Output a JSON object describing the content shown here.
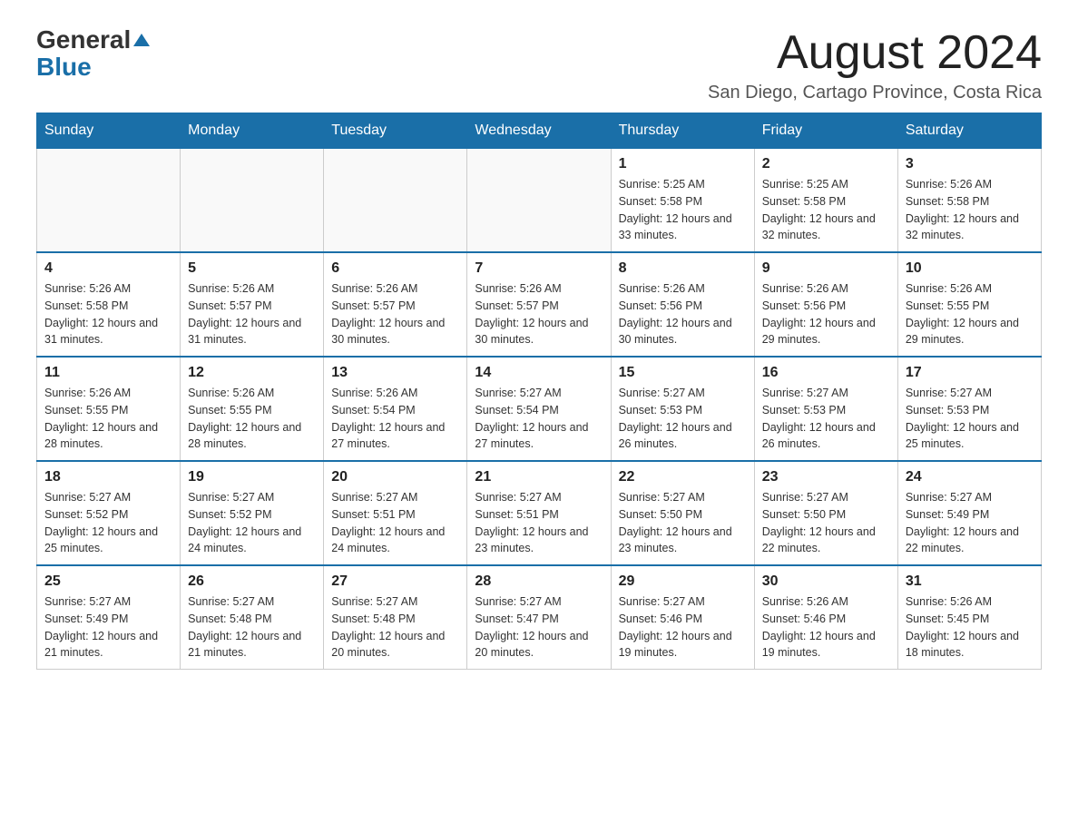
{
  "header": {
    "logo_general": "General",
    "logo_blue": "Blue",
    "month_title": "August 2024",
    "location": "San Diego, Cartago Province, Costa Rica"
  },
  "days_of_week": [
    "Sunday",
    "Monday",
    "Tuesday",
    "Wednesday",
    "Thursday",
    "Friday",
    "Saturday"
  ],
  "weeks": [
    {
      "days": [
        {
          "number": "",
          "info": ""
        },
        {
          "number": "",
          "info": ""
        },
        {
          "number": "",
          "info": ""
        },
        {
          "number": "",
          "info": ""
        },
        {
          "number": "1",
          "info": "Sunrise: 5:25 AM\nSunset: 5:58 PM\nDaylight: 12 hours and 33 minutes."
        },
        {
          "number": "2",
          "info": "Sunrise: 5:25 AM\nSunset: 5:58 PM\nDaylight: 12 hours and 32 minutes."
        },
        {
          "number": "3",
          "info": "Sunrise: 5:26 AM\nSunset: 5:58 PM\nDaylight: 12 hours and 32 minutes."
        }
      ]
    },
    {
      "days": [
        {
          "number": "4",
          "info": "Sunrise: 5:26 AM\nSunset: 5:58 PM\nDaylight: 12 hours and 31 minutes."
        },
        {
          "number": "5",
          "info": "Sunrise: 5:26 AM\nSunset: 5:57 PM\nDaylight: 12 hours and 31 minutes."
        },
        {
          "number": "6",
          "info": "Sunrise: 5:26 AM\nSunset: 5:57 PM\nDaylight: 12 hours and 30 minutes."
        },
        {
          "number": "7",
          "info": "Sunrise: 5:26 AM\nSunset: 5:57 PM\nDaylight: 12 hours and 30 minutes."
        },
        {
          "number": "8",
          "info": "Sunrise: 5:26 AM\nSunset: 5:56 PM\nDaylight: 12 hours and 30 minutes."
        },
        {
          "number": "9",
          "info": "Sunrise: 5:26 AM\nSunset: 5:56 PM\nDaylight: 12 hours and 29 minutes."
        },
        {
          "number": "10",
          "info": "Sunrise: 5:26 AM\nSunset: 5:55 PM\nDaylight: 12 hours and 29 minutes."
        }
      ]
    },
    {
      "days": [
        {
          "number": "11",
          "info": "Sunrise: 5:26 AM\nSunset: 5:55 PM\nDaylight: 12 hours and 28 minutes."
        },
        {
          "number": "12",
          "info": "Sunrise: 5:26 AM\nSunset: 5:55 PM\nDaylight: 12 hours and 28 minutes."
        },
        {
          "number": "13",
          "info": "Sunrise: 5:26 AM\nSunset: 5:54 PM\nDaylight: 12 hours and 27 minutes."
        },
        {
          "number": "14",
          "info": "Sunrise: 5:27 AM\nSunset: 5:54 PM\nDaylight: 12 hours and 27 minutes."
        },
        {
          "number": "15",
          "info": "Sunrise: 5:27 AM\nSunset: 5:53 PM\nDaylight: 12 hours and 26 minutes."
        },
        {
          "number": "16",
          "info": "Sunrise: 5:27 AM\nSunset: 5:53 PM\nDaylight: 12 hours and 26 minutes."
        },
        {
          "number": "17",
          "info": "Sunrise: 5:27 AM\nSunset: 5:53 PM\nDaylight: 12 hours and 25 minutes."
        }
      ]
    },
    {
      "days": [
        {
          "number": "18",
          "info": "Sunrise: 5:27 AM\nSunset: 5:52 PM\nDaylight: 12 hours and 25 minutes."
        },
        {
          "number": "19",
          "info": "Sunrise: 5:27 AM\nSunset: 5:52 PM\nDaylight: 12 hours and 24 minutes."
        },
        {
          "number": "20",
          "info": "Sunrise: 5:27 AM\nSunset: 5:51 PM\nDaylight: 12 hours and 24 minutes."
        },
        {
          "number": "21",
          "info": "Sunrise: 5:27 AM\nSunset: 5:51 PM\nDaylight: 12 hours and 23 minutes."
        },
        {
          "number": "22",
          "info": "Sunrise: 5:27 AM\nSunset: 5:50 PM\nDaylight: 12 hours and 23 minutes."
        },
        {
          "number": "23",
          "info": "Sunrise: 5:27 AM\nSunset: 5:50 PM\nDaylight: 12 hours and 22 minutes."
        },
        {
          "number": "24",
          "info": "Sunrise: 5:27 AM\nSunset: 5:49 PM\nDaylight: 12 hours and 22 minutes."
        }
      ]
    },
    {
      "days": [
        {
          "number": "25",
          "info": "Sunrise: 5:27 AM\nSunset: 5:49 PM\nDaylight: 12 hours and 21 minutes."
        },
        {
          "number": "26",
          "info": "Sunrise: 5:27 AM\nSunset: 5:48 PM\nDaylight: 12 hours and 21 minutes."
        },
        {
          "number": "27",
          "info": "Sunrise: 5:27 AM\nSunset: 5:48 PM\nDaylight: 12 hours and 20 minutes."
        },
        {
          "number": "28",
          "info": "Sunrise: 5:27 AM\nSunset: 5:47 PM\nDaylight: 12 hours and 20 minutes."
        },
        {
          "number": "29",
          "info": "Sunrise: 5:27 AM\nSunset: 5:46 PM\nDaylight: 12 hours and 19 minutes."
        },
        {
          "number": "30",
          "info": "Sunrise: 5:26 AM\nSunset: 5:46 PM\nDaylight: 12 hours and 19 minutes."
        },
        {
          "number": "31",
          "info": "Sunrise: 5:26 AM\nSunset: 5:45 PM\nDaylight: 12 hours and 18 minutes."
        }
      ]
    }
  ]
}
